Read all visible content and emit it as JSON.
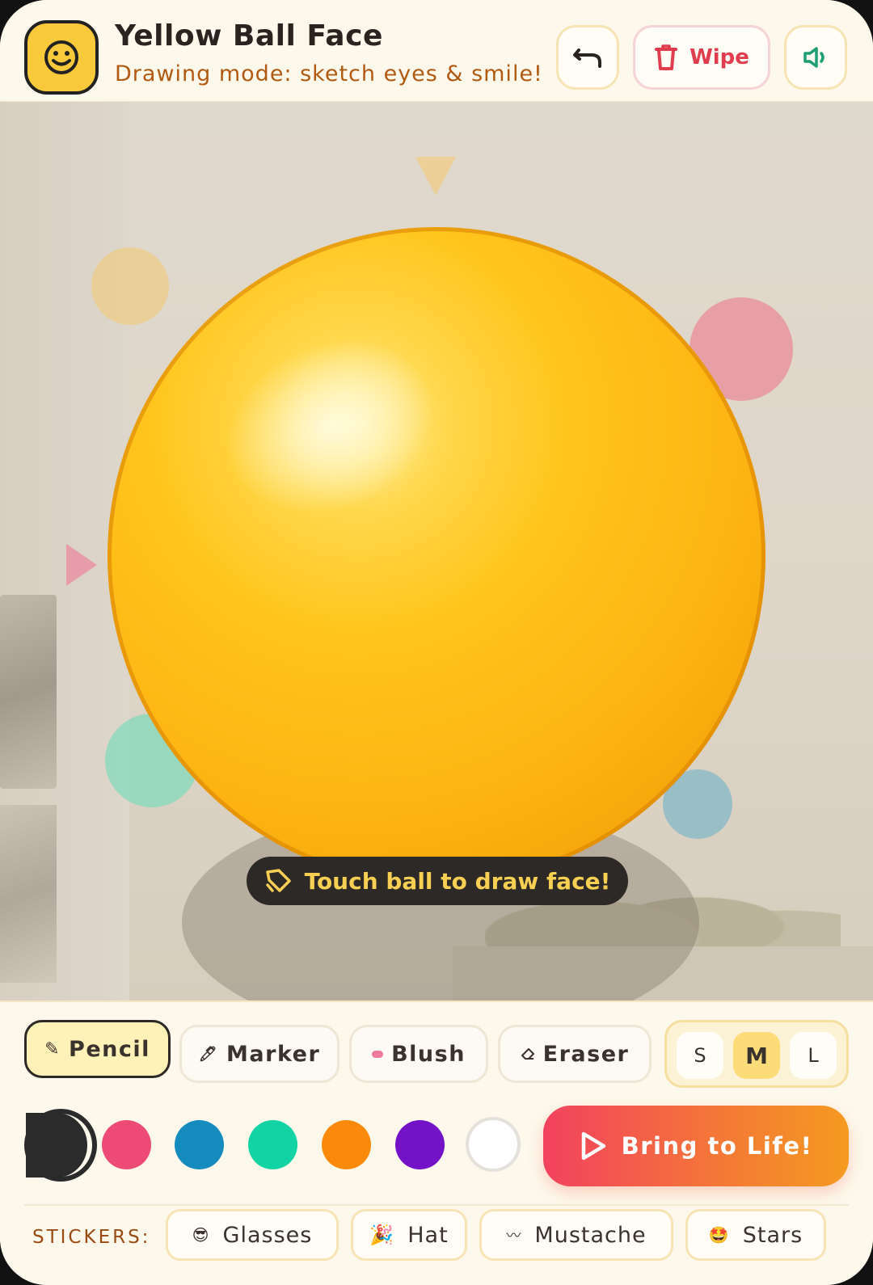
{
  "header": {
    "title": "Yellow Ball Face",
    "subtitle": "Drawing mode: sketch eyes & smile!",
    "app_icon": "smiley-icon",
    "undo_icon": "undo-icon",
    "wipe_label": "Wipe",
    "wipe_icon": "trash-icon",
    "sound_icon": "speaker-icon"
  },
  "stage": {
    "hint": "Touch ball to draw face!",
    "hint_icon": "pencil-tag-icon",
    "ball_color": "#FDB513"
  },
  "tools": {
    "items": [
      {
        "label": "Pencil",
        "icon": "pencil-icon",
        "active": true
      },
      {
        "label": "Marker",
        "icon": "marker-icon",
        "active": false
      },
      {
        "label": "Blush",
        "icon": "blush-icon",
        "active": false
      },
      {
        "label": "Eraser",
        "icon": "eraser-icon",
        "active": false
      }
    ],
    "sizes": [
      {
        "label": "S",
        "active": false
      },
      {
        "label": "M",
        "active": true
      },
      {
        "label": "L",
        "active": false
      }
    ]
  },
  "colors": {
    "selected": "#2B2B2B",
    "swatches": [
      "#2B2B2B",
      "#EE4A76",
      "#168BBE",
      "#12D3A3",
      "#FB8A0C",
      "#7312C6",
      "#FFFFFF"
    ]
  },
  "action": {
    "bring_label": "Bring to Life!",
    "bring_icon": "play-icon"
  },
  "stickers": {
    "label": "STICKERS:",
    "items": [
      {
        "label": "Glasses",
        "emoji": "😎"
      },
      {
        "label": "Hat",
        "emoji": "🎉"
      },
      {
        "label": "Mustache",
        "emoji": "〰"
      },
      {
        "label": "Stars",
        "emoji": "🤩"
      }
    ]
  }
}
